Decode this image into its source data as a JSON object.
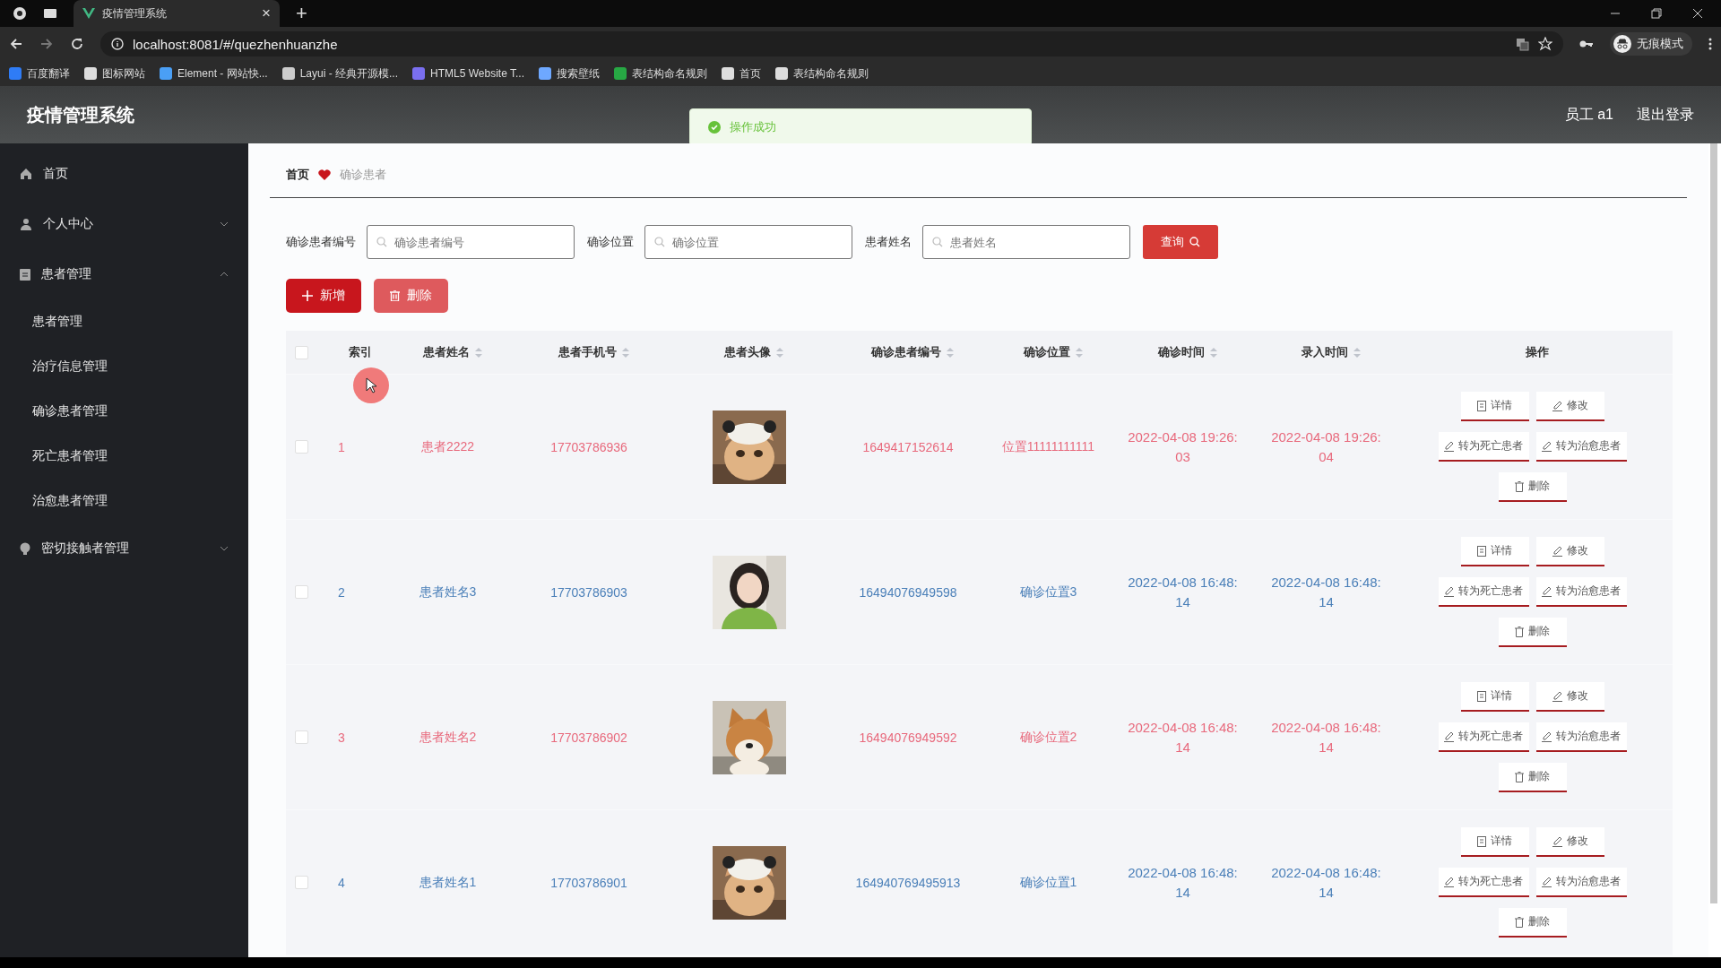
{
  "browser": {
    "tab_title": "疫情管理系统",
    "new_tab": "+",
    "tab_close": "×",
    "address": "localhost:8081/#/quezhenhuanzhe",
    "incognito": "无痕模式",
    "bookmarks": [
      {
        "label": "百度翻译",
        "kind": "translate"
      },
      {
        "label": "图标网站",
        "kind": "flag"
      },
      {
        "label": "Element - 网站快...",
        "kind": "element"
      },
      {
        "label": "Layui - 经典开源模...",
        "kind": "layui"
      },
      {
        "label": "HTML5 Website T...",
        "kind": "html5"
      },
      {
        "label": "搜索壁纸",
        "kind": "wallpaper"
      },
      {
        "label": "表结构命名规则",
        "kind": "sheet"
      },
      {
        "label": "首页",
        "kind": "globe"
      },
      {
        "label": "表结构命名规则",
        "kind": "globe"
      }
    ]
  },
  "app": {
    "title": "疫情管理系统",
    "user": "员工 a1",
    "logout": "退出登录"
  },
  "toast": {
    "message": "操作成功"
  },
  "sidebar": {
    "items": [
      {
        "label": "首页"
      },
      {
        "label": "个人中心",
        "expanded": false
      },
      {
        "label": "患者管理",
        "expanded": true,
        "children": [
          {
            "label": "患者管理"
          },
          {
            "label": "治疗信息管理"
          },
          {
            "label": "确诊患者管理"
          },
          {
            "label": "死亡患者管理"
          },
          {
            "label": "治愈患者管理"
          }
        ]
      },
      {
        "label": "密切接触者管理",
        "expanded": false
      }
    ]
  },
  "breadcrumb": {
    "home": "首页",
    "current": "确诊患者"
  },
  "search": {
    "fields": [
      {
        "label": "确诊患者编号",
        "placeholder": "确诊患者编号"
      },
      {
        "label": "确诊位置",
        "placeholder": "确诊位置"
      },
      {
        "label": "患者姓名",
        "placeholder": "患者姓名"
      }
    ],
    "button": "查询"
  },
  "toolbar": [
    {
      "label": "新增",
      "kind": "add"
    },
    {
      "label": "删除",
      "kind": "delete"
    }
  ],
  "table": {
    "header_checked": false,
    "columns": [
      {
        "label": "索引",
        "sortable": false
      },
      {
        "label": "患者姓名",
        "sortable": true
      },
      {
        "label": "患者手机号",
        "sortable": true
      },
      {
        "label": "患者头像",
        "sortable": true
      },
      {
        "label": "确诊患者编号",
        "sortable": true
      },
      {
        "label": "确诊位置",
        "sortable": true
      },
      {
        "label": "确诊时间",
        "sortable": true
      },
      {
        "label": "录入时间",
        "sortable": true
      },
      {
        "label": "操作",
        "sortable": false
      }
    ],
    "rows": [
      {
        "checked": false,
        "color": "#e8697c",
        "index": "1",
        "name": "患者2222",
        "phone": "17703786936",
        "code": "1649417152614",
        "location": "位置11111111111",
        "confirmed_time": "2022-04-08 19:26:03",
        "entry_time": "2022-04-08 19:26:04",
        "actions": [
          {
            "label": "详情",
            "kind": "detail"
          },
          {
            "label": "修改",
            "kind": "edit"
          },
          {
            "label": "转为死亡患者",
            "kind": "edit"
          },
          {
            "label": "转为治愈患者",
            "kind": "edit"
          },
          {
            "label": "删除",
            "kind": "delete"
          }
        ]
      },
      {
        "checked": false,
        "color": "#4a7fb8",
        "index": "2",
        "name": "患者姓名3",
        "phone": "17703786903",
        "code": "16494076949598",
        "location": "确诊位置3",
        "confirmed_time": "2022-04-08 16:48:14",
        "entry_time": "2022-04-08 16:48:14",
        "actions": [
          {
            "label": "详情",
            "kind": "detail"
          },
          {
            "label": "修改",
            "kind": "edit"
          },
          {
            "label": "转为死亡患者",
            "kind": "edit"
          },
          {
            "label": "转为治愈患者",
            "kind": "edit"
          },
          {
            "label": "删除",
            "kind": "delete"
          }
        ]
      },
      {
        "checked": false,
        "color": "#e8697c",
        "index": "3",
        "name": "患者姓名2",
        "phone": "17703786902",
        "code": "16494076949592",
        "location": "确诊位置2",
        "confirmed_time": "2022-04-08 16:48:14",
        "entry_time": "2022-04-08 16:48:14",
        "actions": [
          {
            "label": "详情",
            "kind": "detail"
          },
          {
            "label": "修改",
            "kind": "edit"
          },
          {
            "label": "转为死亡患者",
            "kind": "edit"
          },
          {
            "label": "转为治愈患者",
            "kind": "edit"
          },
          {
            "label": "删除",
            "kind": "delete"
          }
        ]
      },
      {
        "checked": false,
        "color": "#4a7fb8",
        "index": "4",
        "name": "患者姓名1",
        "phone": "17703786901",
        "code": "164940769495913",
        "location": "确诊位置1",
        "confirmed_time": "2022-04-08 16:48:14",
        "entry_time": "2022-04-08 16:48:14",
        "actions": [
          {
            "label": "详情",
            "kind": "detail"
          },
          {
            "label": "修改",
            "kind": "edit"
          },
          {
            "label": "转为死亡患者",
            "kind": "edit"
          },
          {
            "label": "转为治愈患者",
            "kind": "edit"
          },
          {
            "label": "删除",
            "kind": "delete"
          }
        ]
      }
    ]
  }
}
